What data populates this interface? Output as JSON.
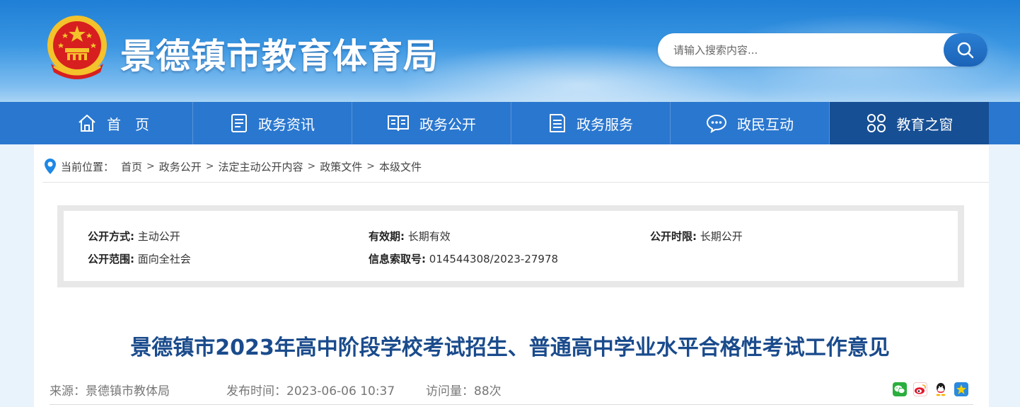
{
  "header": {
    "site_title": "景德镇市教育体育局",
    "search": {
      "placeholder": "请输入搜索内容..."
    }
  },
  "nav": {
    "items": [
      {
        "label": "首　页",
        "icon": "home-icon"
      },
      {
        "label": "政务资讯",
        "icon": "news-icon"
      },
      {
        "label": "政务公开",
        "icon": "book-icon"
      },
      {
        "label": "政务服务",
        "icon": "document-icon"
      },
      {
        "label": "政民互动",
        "icon": "chat-icon"
      },
      {
        "label": "教育之窗",
        "icon": "grid-icon",
        "active": true
      }
    ]
  },
  "breadcrumb": {
    "prefix": "当前位置：",
    "items": [
      "首页",
      "政务公开",
      "法定主动公开内容",
      "政策文件",
      "本级文件"
    ],
    "separator": ">"
  },
  "meta": {
    "disclosure_method_label": "公开方式:",
    "disclosure_method_value": "主动公开",
    "validity_label": "有效期:",
    "validity_value": "长期有效",
    "disclosure_time_label": "公开时限:",
    "disclosure_time_value": "长期公开",
    "disclosure_scope_label": "公开范围:",
    "disclosure_scope_value": "面向全社会",
    "index_no_label": "信息索取号:",
    "index_no_value": "014544308/2023-27978"
  },
  "article": {
    "title": "景德镇市2023年高中阶段学校考试招生、普通高中学业水平合格性考试工作意见",
    "source": "来源：景德镇市教体局",
    "publish_time": "发布时间：2023-06-06 10:37",
    "views": "访问量：88次"
  },
  "share": {
    "icons": [
      "wechat-icon",
      "weibo-icon",
      "qq-icon",
      "qzone-icon"
    ],
    "colors": {
      "wechat": "#2aae3d",
      "weibo": "#e6162d",
      "qq": "#1b1b1b",
      "qzone": "#f5b400"
    }
  },
  "colors": {
    "header_blue": "#1f7fd6",
    "nav_blue": "#2a77cf",
    "nav_active": "#164f94",
    "title_blue": "#1a4b8c"
  }
}
